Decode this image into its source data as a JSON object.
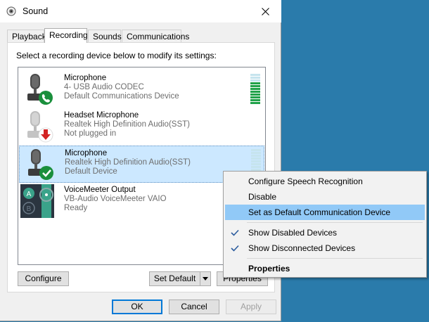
{
  "window": {
    "title": "Sound",
    "close_icon": "close-icon"
  },
  "tabs": [
    {
      "label": "Playback",
      "active": false
    },
    {
      "label": "Recording",
      "active": true
    },
    {
      "label": "Sounds",
      "active": false
    },
    {
      "label": "Communications",
      "active": false
    }
  ],
  "instructions": "Select a recording device below to modify its settings:",
  "devices": [
    {
      "name": "Microphone",
      "line2": "4- USB Audio CODEC",
      "status": "Default Communications Device",
      "icon": "microphone-icon",
      "badge": "phone-badge",
      "badge_color": "#1a8f3c",
      "level": 0.7
    },
    {
      "name": "Headset Microphone",
      "line2": "Realtek High Definition Audio(SST)",
      "status": "Not plugged in",
      "icon": "microphone-icon",
      "badge": "down-arrow-badge",
      "badge_color": "#d32424"
    },
    {
      "name": "Microphone",
      "line2": "Realtek High Definition Audio(SST)",
      "status": "Default Device",
      "icon": "microphone-icon",
      "badge": "check-badge",
      "badge_color": "#1a8f3c",
      "level": 0,
      "selected": true
    },
    {
      "name": "VoiceMeeter Output",
      "line2": "VB-Audio VoiceMeeter VAIO",
      "status": "Ready",
      "icon": "voicemeeter-icon"
    }
  ],
  "buttons": {
    "configure": "Configure",
    "set_default": "Set Default",
    "properties": "Properties",
    "ok": "OK",
    "cancel": "Cancel",
    "apply": "Apply"
  },
  "context_menu": {
    "items": [
      {
        "label": "Configure Speech Recognition"
      },
      {
        "label": "Disable"
      },
      {
        "label": "Set as Default Communication Device",
        "highlighted": true
      },
      {
        "label": "Show Disabled Devices",
        "checked": true
      },
      {
        "label": "Show Disconnected Devices",
        "checked": true
      },
      {
        "label": "Properties",
        "bold": true
      }
    ]
  },
  "colors": {
    "desktop": "#2a7bab",
    "selection": "#cce8ff",
    "menu_highlight": "#91c9f7",
    "accent": "#0078d7"
  }
}
